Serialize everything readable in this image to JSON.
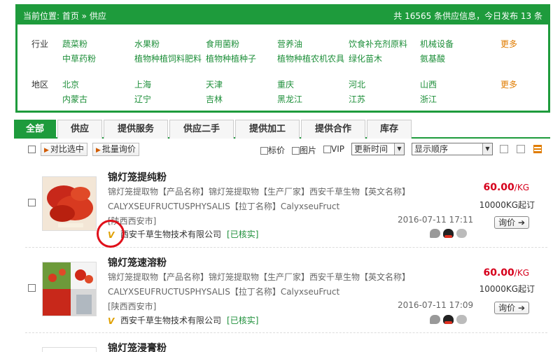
{
  "header": {
    "breadcrumb": "当前位置: 首页 » 供应",
    "stats": "共 16565 条供应信息，今日发布 13 条"
  },
  "filters": {
    "industry": {
      "label": "行业",
      "items": [
        "蔬菜粉",
        "水果粉",
        "食用菌粉",
        "营养油",
        "饮食补充剂原料",
        "机械设备",
        "中草药粉",
        "植物种植饲料肥料",
        "植物种植种子",
        "植物种植农机农具",
        "绿化苗木",
        "氨基酸"
      ],
      "more": "更多"
    },
    "region": {
      "label": "地区",
      "items": [
        "北京",
        "上海",
        "天津",
        "重庆",
        "河北",
        "山西",
        "内蒙古",
        "辽宁",
        "吉林",
        "黑龙江",
        "江苏",
        "浙江"
      ],
      "more": "更多"
    }
  },
  "tabs": [
    "全部",
    "供应",
    "提供服务",
    "供应二手",
    "提供加工",
    "提供合作",
    "库存"
  ],
  "toolbar": {
    "compare": "对比选中",
    "bulk_inquiry": "批量询价",
    "filter_price": "标价",
    "filter_image": "图片",
    "filter_vip": "VIP",
    "sort_select": "更新时间",
    "display_select": "显示顺序"
  },
  "products": [
    {
      "title": "锦灯笼提纯粉",
      "desc1": "锦灯笼提取物【产品名称】锦灯笼提取物【生产厂家】西安千草生物【英文名称】",
      "desc2": "CALYXSEUFRUCTUSPHYSALIS【拉丁名称】CalyxseuFruct",
      "location": "[陕西西安市]",
      "date": "2016-07-11 17:11",
      "company": "西安千草生物技术有限公司",
      "verified": "[已核实]",
      "price": "60.00",
      "unit": "/KG",
      "moq": "10000KG起订",
      "inquiry": "询价"
    },
    {
      "title": "锦灯笼速溶粉",
      "desc1": "锦灯笼提取物【产品名称】锦灯笼提取物【生产厂家】西安千草生物【英文名称】",
      "desc2": "CALYXSEUFRUCTUSPHYSALIS【拉丁名称】CalyxseuFruct",
      "location": "[陕西西安市]",
      "date": "2016-07-11 17:09",
      "company": "西安千草生物技术有限公司",
      "verified": "[已核实]",
      "price": "60.00",
      "unit": "/KG",
      "moq": "10000KG起订",
      "inquiry": "询价"
    },
    {
      "title": "锦灯笼浸膏粉"
    }
  ]
}
